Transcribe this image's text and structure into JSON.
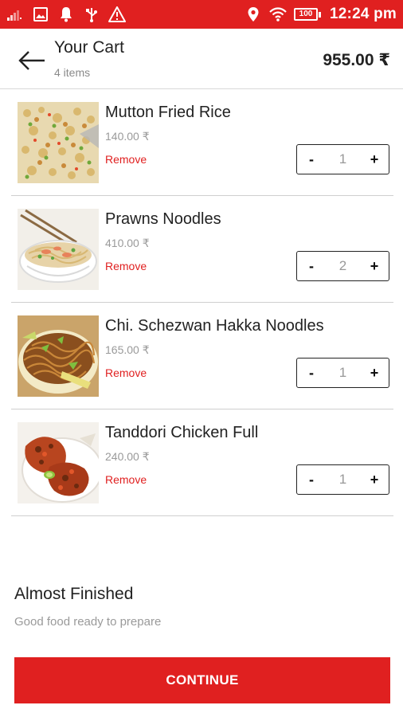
{
  "status_bar": {
    "time": "12:24 pm",
    "battery": "100",
    "icons_left": [
      "signal-icon",
      "image-icon",
      "notification-bell-icon",
      "usb-icon",
      "warning-icon"
    ],
    "icons_right": [
      "location-icon",
      "wifi-icon",
      "battery-icon"
    ]
  },
  "header": {
    "title": "Your Cart",
    "subtitle": "4 items",
    "total": "955.00 ₹",
    "back_icon": "arrow-back-icon"
  },
  "cart": {
    "items": [
      {
        "name": "Mutton Fried Rice",
        "price": "140.00 ₹",
        "remove_label": "Remove",
        "quantity": "1",
        "minus": "-",
        "plus": "+",
        "image": "fried-rice-image"
      },
      {
        "name": "Prawns Noodles",
        "price": "410.00 ₹",
        "remove_label": "Remove",
        "quantity": "2",
        "minus": "-",
        "plus": "+",
        "image": "noodle-bowl-image"
      },
      {
        "name": "Chi. Schezwan Hakka Noodles",
        "price": "165.00 ₹",
        "remove_label": "Remove",
        "quantity": "1",
        "minus": "-",
        "plus": "+",
        "image": "hakka-noodles-image"
      },
      {
        "name": "Tanddori Chicken Full",
        "price": "240.00 ₹",
        "remove_label": "Remove",
        "quantity": "1",
        "minus": "-",
        "plus": "+",
        "image": "tandoori-chicken-image"
      }
    ]
  },
  "footer": {
    "title": "Almost Finished",
    "subtitle": "Good food ready to prepare",
    "continue_label": "CONTINUE"
  },
  "colors": {
    "accent": "#e02020",
    "text": "#222222",
    "muted": "#9a9a9a",
    "divider": "#cfcfcf"
  }
}
